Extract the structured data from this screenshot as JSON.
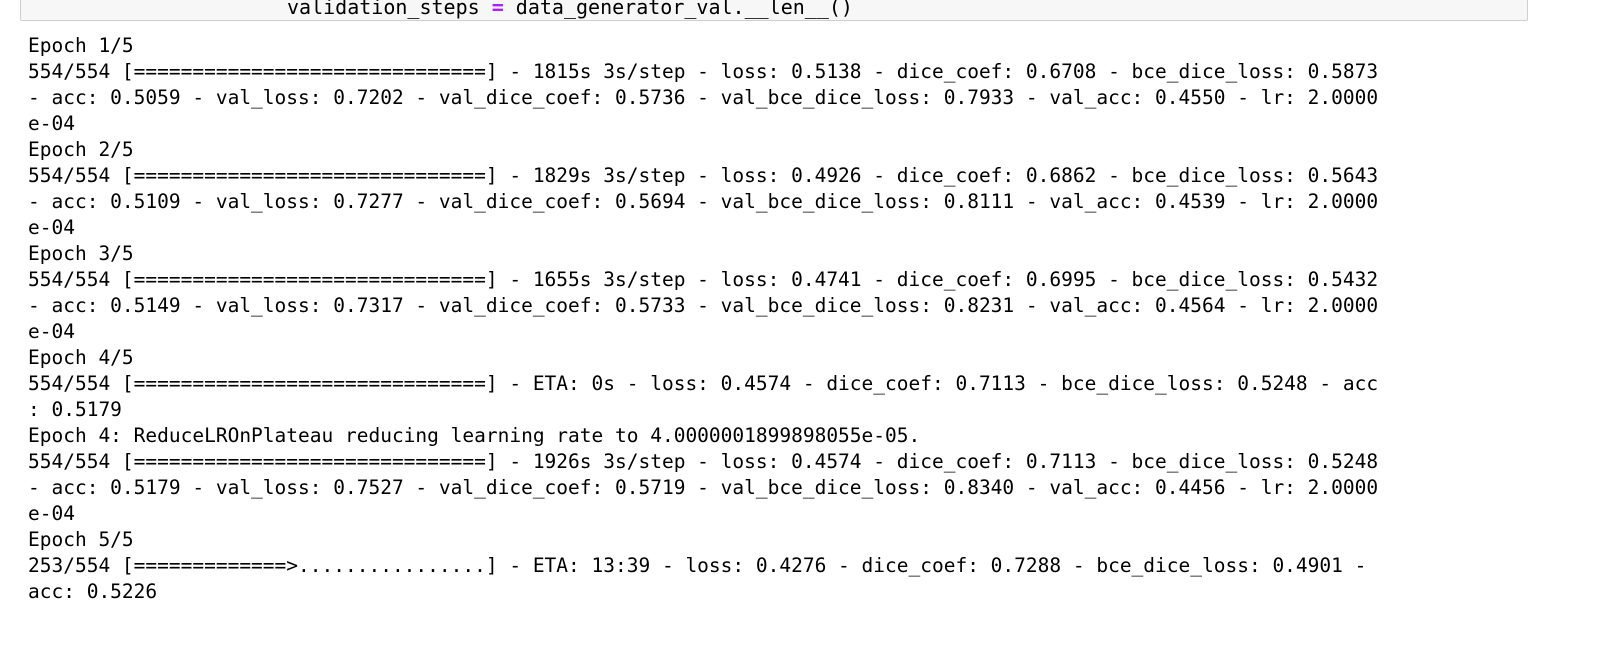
{
  "code_cell": {
    "line_left": "validation_steps ",
    "line_op": "=",
    "line_right": " data_generator_val.__len__()"
  },
  "output": {
    "lines": [
      "Epoch 1/5",
      "554/554 [==============================] - 1815s 3s/step - loss: 0.5138 - dice_coef: 0.6708 - bce_dice_loss: 0.5873",
      "- acc: 0.5059 - val_loss: 0.7202 - val_dice_coef: 0.5736 - val_bce_dice_loss: 0.7933 - val_acc: 0.4550 - lr: 2.0000",
      "e-04",
      "Epoch 2/5",
      "554/554 [==============================] - 1829s 3s/step - loss: 0.4926 - dice_coef: 0.6862 - bce_dice_loss: 0.5643",
      "- acc: 0.5109 - val_loss: 0.7277 - val_dice_coef: 0.5694 - val_bce_dice_loss: 0.8111 - val_acc: 0.4539 - lr: 2.0000",
      "e-04",
      "Epoch 3/5",
      "554/554 [==============================] - 1655s 3s/step - loss: 0.4741 - dice_coef: 0.6995 - bce_dice_loss: 0.5432",
      "- acc: 0.5149 - val_loss: 0.7317 - val_dice_coef: 0.5733 - val_bce_dice_loss: 0.8231 - val_acc: 0.4564 - lr: 2.0000",
      "e-04",
      "Epoch 4/5",
      "554/554 [==============================] - ETA: 0s - loss: 0.4574 - dice_coef: 0.7113 - bce_dice_loss: 0.5248 - acc",
      ": 0.5179",
      "Epoch 4: ReduceLROnPlateau reducing learning rate to 4.0000001899898055e-05.",
      "554/554 [==============================] - 1926s 3s/step - loss: 0.4574 - dice_coef: 0.7113 - bce_dice_loss: 0.5248",
      "- acc: 0.5179 - val_loss: 0.7527 - val_dice_coef: 0.5719 - val_bce_dice_loss: 0.8340 - val_acc: 0.4456 - lr: 2.0000",
      "e-04",
      "Epoch 5/5",
      "253/554 [=============>................] - ETA: 13:39 - loss: 0.4276 - dice_coef: 0.7288 - bce_dice_loss: 0.4901 -",
      "acc: 0.5226"
    ]
  }
}
